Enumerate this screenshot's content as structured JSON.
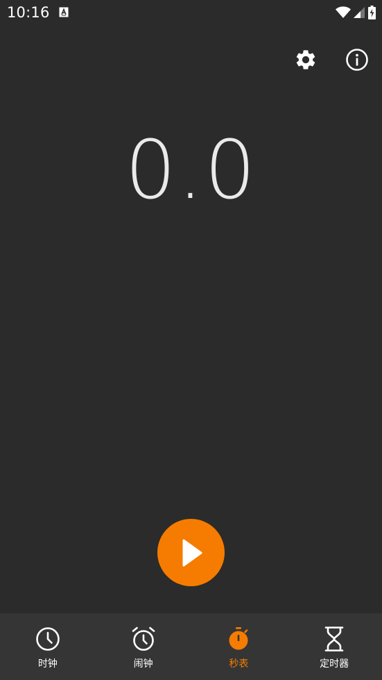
{
  "status_bar": {
    "time": "10:16",
    "icons": [
      "a-notification-icon",
      "wifi-icon",
      "signal-icon",
      "battery-charging-icon"
    ]
  },
  "toolbar": {
    "settings_icon": "gear-icon",
    "info_icon": "info-icon"
  },
  "stopwatch": {
    "elapsed": "0.0",
    "start_icon": "play-icon"
  },
  "bottom_nav": {
    "items": [
      {
        "label": "时钟",
        "icon": "clock-icon",
        "active": false
      },
      {
        "label": "闹钟",
        "icon": "alarm-clock-icon",
        "active": false
      },
      {
        "label": "秒表",
        "icon": "stopwatch-icon",
        "active": true
      },
      {
        "label": "定时器",
        "icon": "hourglass-icon",
        "active": false
      }
    ]
  },
  "colors": {
    "background": "#2b2b2b",
    "nav_background": "#353535",
    "accent": "#f57c00",
    "text": "#ffffff"
  }
}
